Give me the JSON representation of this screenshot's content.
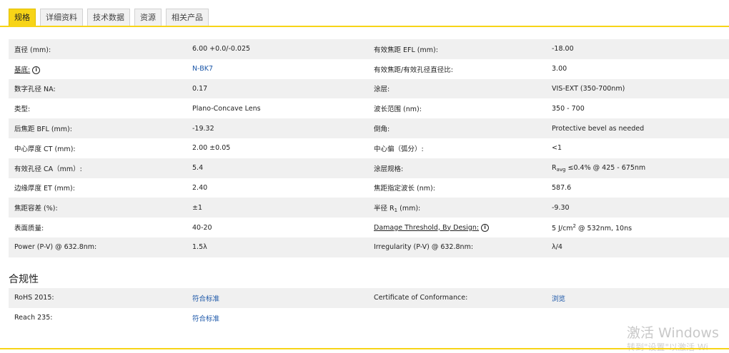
{
  "tabs": [
    {
      "label": "规格",
      "active": true
    },
    {
      "label": "详细资料"
    },
    {
      "label": "技术数据"
    },
    {
      "label": "资源"
    },
    {
      "label": "相关产品"
    }
  ],
  "specs": {
    "rows": [
      {
        "l1": "直径 (mm):",
        "v1": "6.00 +0.0/-0.025",
        "l2": "有效焦距 EFL (mm):",
        "v2": "-18.00"
      },
      {
        "l1": "基底:",
        "v1": "N-BK7",
        "l2": "有效焦距/有效孔径直径比:",
        "v2": "3.00"
      },
      {
        "l1": "数字孔径 NA:",
        "v1": "0.17",
        "l2": "涂层:",
        "v2": "VIS-EXT (350-700nm)"
      },
      {
        "l1": "类型:",
        "v1": "Plano-Concave Lens",
        "l2": "波长范围 (nm):",
        "v2": "350 - 700"
      },
      {
        "l1": "后焦距 BFL (mm):",
        "v1": "-19.32",
        "l2": "倒角:",
        "v2": "Protective bevel as needed"
      },
      {
        "l1": "中心厚度 CT (mm):",
        "v1": "2.00 ±0.05",
        "l2": "中心偏（弧分）:",
        "v2": "<1"
      },
      {
        "l1": "有效孔径 CA（mm）:",
        "v1": "5.4",
        "l2": "涂层规格:",
        "v2a": "R",
        "v2sub": "avg",
        "v2b": " ≤0.4% @ 425 - 675nm"
      },
      {
        "l1": "边缘厚度 ET (mm):",
        "v1": "2.40",
        "l2": "焦距指定波长 (nm):",
        "v2": "587.6"
      },
      {
        "l1": "焦距容差 (%):",
        "v1": "±1",
        "l2a": "半径 R",
        "l2sub": "1",
        "l2b": " (mm):",
        "v2": "-9.30"
      },
      {
        "l1": "表面质量:",
        "v1": "40-20",
        "l2": "Damage Threshold, By Design:",
        "v2a": "5 J/cm",
        "v2sup": "2",
        "v2b": " @ 532nm, 10ns"
      },
      {
        "l1": "Power (P-V) @ 632.8nm:",
        "v1": "1.5λ",
        "l2": "Irregularity (P-V) @ 632.8nm:",
        "v2": "λ/4"
      }
    ]
  },
  "info_icon": {
    "glyph": "i",
    "name": "info-icon"
  },
  "compliance": {
    "title": "合规性",
    "rows": [
      {
        "l1": "RoHS 2015:",
        "v1": "符合标准",
        "l2": "Certificate of Conformance:",
        "v2": "浏览"
      },
      {
        "l1": "Reach 235:",
        "v1": "符合标准",
        "l2": "",
        "v2": ""
      }
    ]
  },
  "watermark": {
    "line1": "激活 Windows",
    "line2": "转到\"设置\"以激活 Wi"
  },
  "colors": {
    "accent": "#f7d417",
    "link": "#1a56a8",
    "row_shade": "#f0f0f0"
  }
}
